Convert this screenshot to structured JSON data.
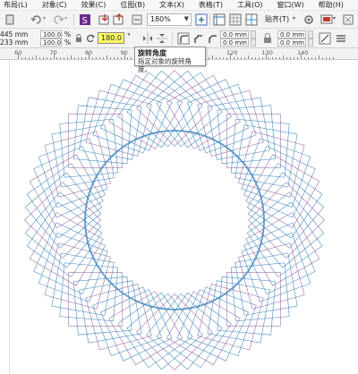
{
  "menu": [
    "布局(L)",
    "对象(C)",
    "效果(C)",
    "位图(B)",
    "文本(X)",
    "表格(T)",
    "工具(O)",
    "窗口(W)",
    "帮助(H)"
  ],
  "toolbar": {
    "zoom_value": "180%",
    "snap_label": "贴齐(T)"
  },
  "property_bar": {
    "width": "445 mm",
    "height": "233 mm",
    "scale_x": "100.0",
    "scale_y": "100.0",
    "percent_unit": "%",
    "rotation_angle": "180.0",
    "degree_sign": "°",
    "offset_1": "0.0 mm",
    "offset_2": "0.0 mm",
    "offset_3": "0.0 mm",
    "offset_4": "0.0 mm"
  },
  "tooltip": {
    "title": "旋转角度",
    "description": "指定对象的旋转角度。"
  },
  "ruler": {
    "labels": [
      "60",
      "70",
      "80",
      "90",
      "100",
      "110",
      "120",
      "130",
      "140"
    ]
  },
  "colors": {
    "accent_highlight": "#ffff66",
    "spiro_blue": "#2e7ab8",
    "spiro_purple": "#8a5a9a"
  },
  "artwork": {
    "shape": "spirograph-ring",
    "line_count": 72
  }
}
